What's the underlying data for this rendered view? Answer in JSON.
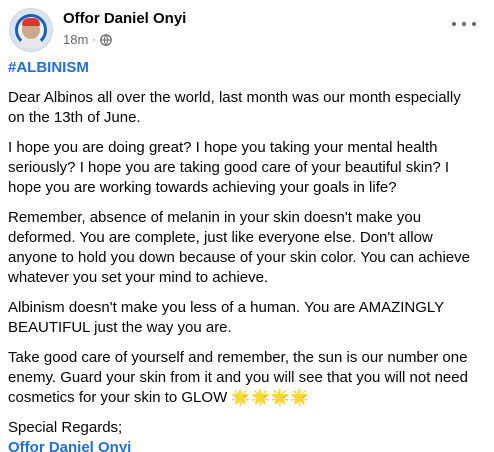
{
  "post": {
    "author": "Offor Daniel Onyi",
    "time": "18m",
    "separator": "·",
    "hashtag": "#ALBINISM",
    "paragraphs": [
      "Dear Albinos all over the world, last month was our month especially on the 13th of June.",
      "I hope you are doing great? I hope you taking your mental health seriously? I hope you are taking good care of your beautiful skin? I hope you are working towards achieving your goals in life?",
      "Remember, absence of melanin in your skin doesn't make you deformed. You are complete, just like everyone else. Don't allow anyone to hold you down because of your skin color. You can achieve whatever you set your mind to achieve.",
      "Albinism doesn't make you less of a human. You are AMAZINGLY BEAUTIFUL just the way you are."
    ],
    "last_paragraph": "Take good care of yourself and remember, the sun is our number one enemy. Guard your skin from it and you will see that you will not need cosmetics for your skin to GLOW",
    "sun_emojis": "🌟🌟🌟🌟",
    "closing": "Special Regards;",
    "signature": "Offor Daniel Onyi"
  },
  "icons": {
    "globe": "globe-icon",
    "more": "more-options-icon"
  },
  "colors": {
    "link": "#216fdb",
    "meta": "#65676b",
    "text": "#050505"
  }
}
